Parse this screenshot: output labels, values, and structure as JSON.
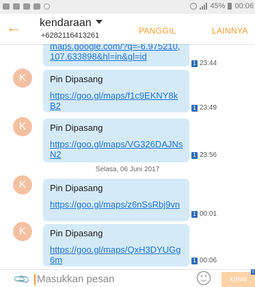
{
  "status_bar": {
    "battery_percent": "45%",
    "time": "00:06",
    "left_icons": [
      "chat-icon",
      "image-icon",
      "mail-icon",
      "mail-icon",
      "circle-icon"
    ]
  },
  "header": {
    "back_icon": "arrow-left-icon",
    "contact_name": "kendaraan",
    "contact_number": "+6282116413261",
    "call_label": "PANGGIL",
    "more_label": "LAINNYA"
  },
  "conversation": {
    "first_partial": {
      "link": "maps.google.com/?q=-6.975210,107.633898&hl=in&gl=id",
      "sim": "1",
      "time": "23:44"
    },
    "messages": [
      {
        "avatar": "K",
        "text": "Pin Dipasang",
        "link": "https://goo.gl/maps/f1c9EKNY8kB2",
        "sim": "1",
        "time": "23:49"
      },
      {
        "avatar": "K",
        "text": "Pin Dipasang",
        "link": "https://goo.gl/maps/VG326DAJNsN2",
        "sim": "1",
        "time": "23:56"
      },
      {
        "avatar": "K",
        "text": "Pin Dipasang",
        "link": "https://goo.gl/maps/z6nSsRbj9vn",
        "sim": "1",
        "time": "00:01"
      },
      {
        "avatar": "K",
        "text": "Pin Dipasang",
        "link": "https://goo.gl/maps/QxH3DYUGg6m",
        "sim": "1",
        "time": "00:06"
      }
    ],
    "date_separator": "Selasa, 06 Juni 2017"
  },
  "input_bar": {
    "placeholder": "Masukkan pesan",
    "send_label": "KIRIM",
    "send_sim": "1",
    "accent": "#f39c2f"
  }
}
